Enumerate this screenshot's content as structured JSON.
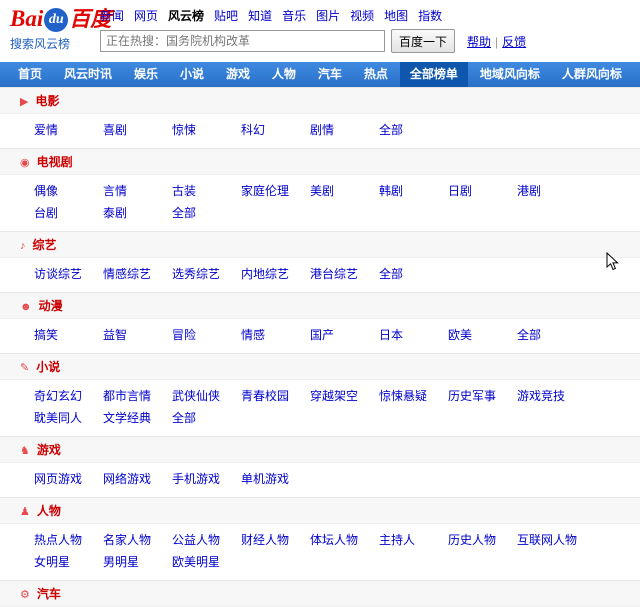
{
  "logo": {
    "bai": "Bai",
    "du": "du",
    "hanzi": "百度",
    "tagline": "搜索风云榜"
  },
  "top_nav": {
    "items": [
      {
        "id": "news",
        "label": "新闻",
        "active": false
      },
      {
        "id": "web",
        "label": "网页",
        "active": false
      },
      {
        "id": "fengyunbang",
        "label": "风云榜",
        "active": true
      },
      {
        "id": "tieba",
        "label": "贴吧",
        "active": false
      },
      {
        "id": "zhidao",
        "label": "知道",
        "active": false
      },
      {
        "id": "music",
        "label": "音乐",
        "active": false
      },
      {
        "id": "image",
        "label": "图片",
        "active": false
      },
      {
        "id": "video",
        "label": "视频",
        "active": false
      },
      {
        "id": "map",
        "label": "地图",
        "active": false
      },
      {
        "id": "index",
        "label": "指数",
        "active": false
      }
    ]
  },
  "search": {
    "placeholder": "正在热搜：国务院机构改革",
    "button": "百度一下",
    "help": "帮助",
    "divider": "|",
    "feedback": "反馈"
  },
  "navbar": {
    "items": [
      {
        "id": "home",
        "label": "首页",
        "active": false
      },
      {
        "id": "fengyun-news",
        "label": "风云时讯",
        "active": false
      },
      {
        "id": "entertainment",
        "label": "娱乐",
        "active": false
      },
      {
        "id": "novel",
        "label": "小说",
        "active": false
      },
      {
        "id": "game",
        "label": "游戏",
        "active": false
      },
      {
        "id": "people",
        "label": "人物",
        "active": false
      },
      {
        "id": "car",
        "label": "汽车",
        "active": false
      },
      {
        "id": "hot",
        "label": "热点",
        "active": false
      },
      {
        "id": "all-lists",
        "label": "全部榜单",
        "active": true
      },
      {
        "id": "region-trend",
        "label": "地域风向标",
        "active": false
      },
      {
        "id": "crowd-trend",
        "label": "人群风向标",
        "active": false
      }
    ]
  },
  "sections": [
    {
      "id": "movie",
      "title": "电影",
      "icon": "movie-icon",
      "glyph": "▶",
      "rows": [
        [
          "爱情",
          "喜剧",
          "惊悚",
          "科幻",
          "剧情",
          "全部"
        ]
      ]
    },
    {
      "id": "tv-series",
      "title": "电视剧",
      "icon": "tv-icon",
      "glyph": "◉",
      "rows": [
        [
          "偶像",
          "言情",
          "古装",
          "家庭伦理",
          "美剧",
          "韩剧",
          "日剧",
          "港剧"
        ],
        [
          "台剧",
          "泰剧",
          "全部"
        ]
      ]
    },
    {
      "id": "variety",
      "title": "综艺",
      "icon": "variety-show-icon",
      "glyph": "♪",
      "rows": [
        [
          "访谈综艺",
          "情感综艺",
          "选秀综艺",
          "内地综艺",
          "港台综艺",
          "全部"
        ]
      ]
    },
    {
      "id": "anime",
      "title": "动漫",
      "icon": "anime-icon",
      "glyph": "☻",
      "rows": [
        [
          "搞笑",
          "益智",
          "冒险",
          "情感",
          "国产",
          "日本",
          "欧美",
          "全部"
        ]
      ]
    },
    {
      "id": "novel",
      "title": "小说",
      "icon": "novel-icon",
      "glyph": "✎",
      "rows": [
        [
          "奇幻玄幻",
          "都市言情",
          "武侠仙侠",
          "青春校园",
          "穿越架空",
          "惊悚悬疑",
          "历史军事",
          "游戏竞技"
        ],
        [
          "耽美同人",
          "文学经典",
          "全部"
        ]
      ]
    },
    {
      "id": "game",
      "title": "游戏",
      "icon": "game-icon",
      "glyph": "♞",
      "rows": [
        [
          "网页游戏",
          "网络游戏",
          "手机游戏",
          "单机游戏"
        ]
      ]
    },
    {
      "id": "people",
      "title": "人物",
      "icon": "people-icon",
      "glyph": "♟",
      "rows": [
        [
          "热点人物",
          "名家人物",
          "公益人物",
          "财经人物",
          "体坛人物",
          "主持人",
          "历史人物",
          "互联网人物"
        ],
        [
          "女明星",
          "男明星",
          "欧美明星"
        ]
      ]
    },
    {
      "id": "car",
      "title": "汽车",
      "icon": "car-icon",
      "glyph": "⚙",
      "rows": []
    }
  ],
  "colors": {
    "navbar_bg": "#2e78d0",
    "navbar_active_bg": "#0f56ad",
    "link_blue": "#0000cc",
    "section_title_red": "#cc0000",
    "logo_red": "#e10601",
    "logo_circle_blue": "#2162c8"
  }
}
